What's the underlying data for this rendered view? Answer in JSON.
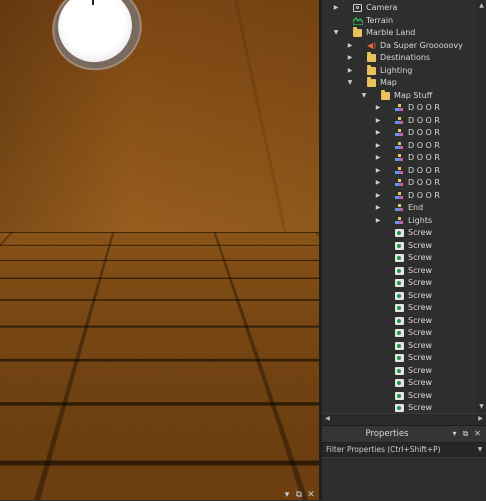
{
  "explorer": {
    "rows": [
      {
        "label": "Camera",
        "icon": "camera-icon",
        "arrow": "collapsed"
      },
      {
        "label": "Terrain",
        "icon": "terrain-icon",
        "arrow": "none"
      },
      {
        "label": "Marble Land",
        "icon": "folder-icon",
        "arrow": "expanded"
      },
      {
        "label": "Da Super Grooooovy",
        "icon": "sound-icon",
        "arrow": "collapsed"
      },
      {
        "label": "Destinations",
        "icon": "folder-icon",
        "arrow": "collapsed"
      },
      {
        "label": "Lighting",
        "icon": "folder-icon",
        "arrow": "collapsed"
      },
      {
        "label": "Map",
        "icon": "folder-icon",
        "arrow": "expanded"
      },
      {
        "label": "Map Stuff",
        "icon": "folder-icon",
        "arrow": "expanded"
      },
      {
        "label": "D O O R",
        "icon": "model-icon",
        "arrow": "collapsed"
      },
      {
        "label": "D O O R",
        "icon": "model-icon",
        "arrow": "collapsed"
      },
      {
        "label": "D O O R",
        "icon": "model-icon",
        "arrow": "collapsed"
      },
      {
        "label": "D O O R",
        "icon": "model-icon",
        "arrow": "collapsed"
      },
      {
        "label": "D O O R",
        "icon": "model-icon",
        "arrow": "collapsed"
      },
      {
        "label": "D O O R",
        "icon": "model-icon",
        "arrow": "collapsed"
      },
      {
        "label": "D O O R",
        "icon": "model-icon",
        "arrow": "collapsed"
      },
      {
        "label": "D O O R",
        "icon": "model-icon",
        "arrow": "collapsed"
      },
      {
        "label": "End",
        "icon": "model-icon",
        "arrow": "collapsed"
      },
      {
        "label": "Lights",
        "icon": "model-icon",
        "arrow": "collapsed"
      },
      {
        "label": "Screw",
        "icon": "script-icon",
        "arrow": "none"
      },
      {
        "label": "Screw",
        "icon": "script-icon",
        "arrow": "none"
      },
      {
        "label": "Screw",
        "icon": "script-icon",
        "arrow": "none"
      },
      {
        "label": "Screw",
        "icon": "script-icon",
        "arrow": "none"
      },
      {
        "label": "Screw",
        "icon": "script-icon",
        "arrow": "none"
      },
      {
        "label": "Screw",
        "icon": "script-icon",
        "arrow": "none"
      },
      {
        "label": "Screw",
        "icon": "script-icon",
        "arrow": "none"
      },
      {
        "label": "Screw",
        "icon": "script-icon",
        "arrow": "none"
      },
      {
        "label": "Screw",
        "icon": "script-icon",
        "arrow": "none"
      },
      {
        "label": "Screw",
        "icon": "script-icon",
        "arrow": "none"
      },
      {
        "label": "Screw",
        "icon": "script-icon",
        "arrow": "none"
      },
      {
        "label": "Screw",
        "icon": "script-icon",
        "arrow": "none"
      },
      {
        "label": "Screw",
        "icon": "script-icon",
        "arrow": "none"
      },
      {
        "label": "Screw",
        "icon": "script-icon",
        "arrow": "none"
      },
      {
        "label": "Screw",
        "icon": "script-icon",
        "arrow": "none"
      }
    ]
  },
  "properties": {
    "title": "Properties",
    "filter_placeholder": "Filter Properties (Ctrl+Shift+P)"
  },
  "colors": {
    "panel_bg": "#2e2e2e",
    "folder": "#e8c25a",
    "script_badge": "#1a9a4a",
    "terrain": "#2fbf5a",
    "sound": "#e0683a",
    "wall": "#8c5418"
  }
}
